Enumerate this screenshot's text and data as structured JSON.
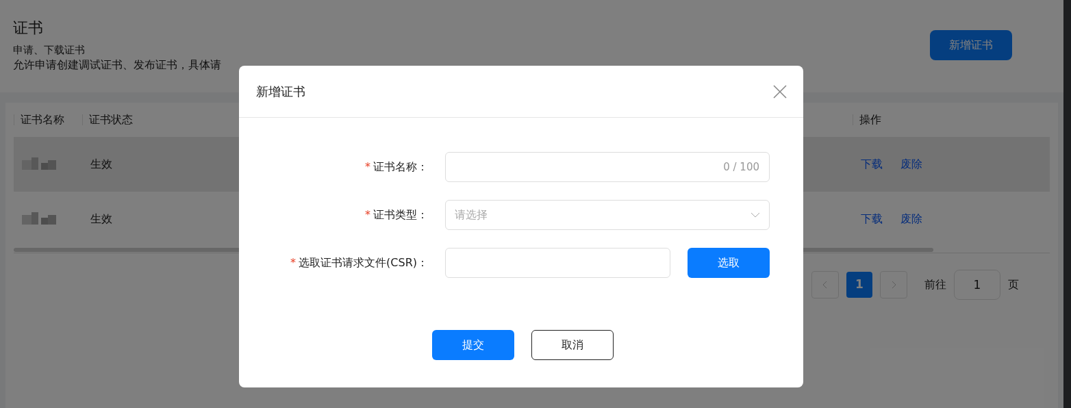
{
  "page": {
    "title": "证书",
    "subtitle": "申请、下载证书",
    "description": "允许申请创建调试证书、发布证书，具体请",
    "add_button": "新增证书"
  },
  "table": {
    "columns": [
      "证书名称",
      "证书状态",
      "操作"
    ],
    "rows": [
      {
        "name": {
          "kind": "redacted"
        },
        "status": "生效",
        "actions": [
          "下载",
          "废除"
        ],
        "selected": true
      },
      {
        "name": {
          "kind": "redacted"
        },
        "status": "生效",
        "actions": [
          "下载",
          "废除"
        ],
        "selected": false
      }
    ]
  },
  "pagination": {
    "pages": [
      {
        "label": "1",
        "selected": true
      }
    ],
    "goto_label": "前往",
    "goto_value": "1",
    "page_suffix": "页"
  },
  "dialog": {
    "title": "新增证书",
    "required_mark": "*",
    "fields": [
      {
        "kind": "text",
        "label": "证书名称：",
        "required": true,
        "counter": "0 / 100"
      },
      {
        "kind": "select",
        "label": "证书类型：",
        "required": true,
        "placeholder": "请选择"
      },
      {
        "kind": "file",
        "label": "选取证书请求文件(CSR)：",
        "required": true,
        "button": "选取"
      }
    ],
    "buttons": [
      {
        "label": "提交",
        "kind": "primary"
      },
      {
        "label": "取消",
        "kind": "default"
      }
    ]
  }
}
